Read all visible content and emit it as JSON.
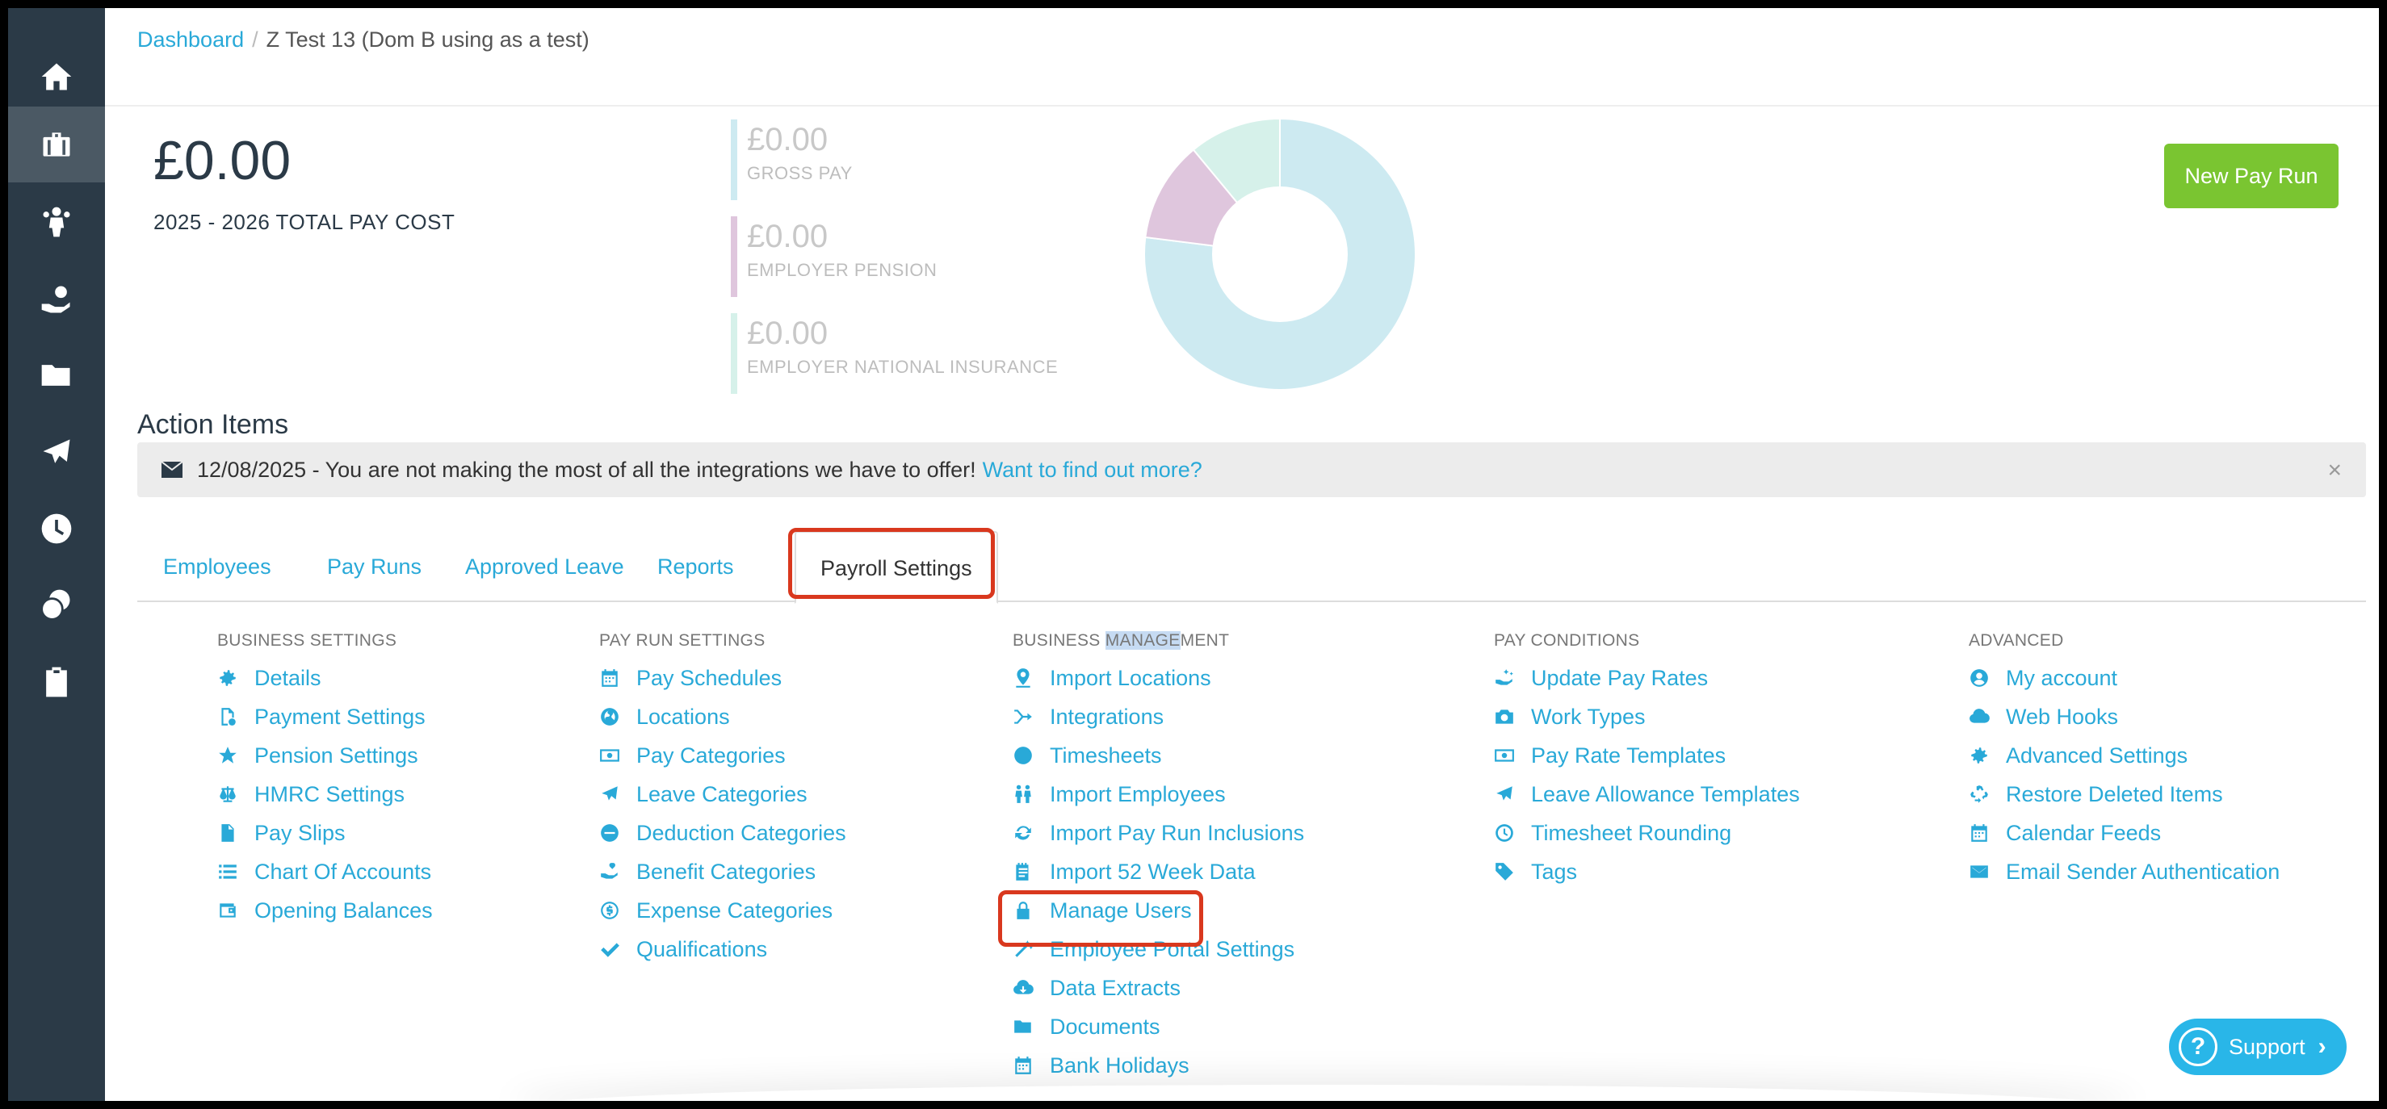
{
  "breadcrumb": {
    "root": "Dashboard",
    "separator": "/",
    "current": "Z Test 13 (Dom B using as a test)"
  },
  "summary": {
    "total_amount": "£0.00",
    "total_label": "2025 - 2026 TOTAL PAY COST",
    "stats": [
      {
        "amount": "£0.00",
        "label": "GROSS PAY",
        "color": "#cdeaf1"
      },
      {
        "amount": "£0.00",
        "label": "EMPLOYER PENSION",
        "color": "#dfc6dd"
      },
      {
        "amount": "£0.00",
        "label": "EMPLOYER NATIONAL INSURANCE",
        "color": "#d6f1ea"
      }
    ],
    "donut": [
      {
        "share": 0.77,
        "color": "#cdeaf1"
      },
      {
        "share": 0.12,
        "color": "#dfc6dd"
      },
      {
        "share": 0.11,
        "color": "#d6f1ea"
      }
    ]
  },
  "new_payrun_label": "New Pay Run",
  "action_items": {
    "title": "Action Items",
    "alert_text": "12/08/2025 - You are not making the most of all the integrations we have to offer!",
    "alert_link": "Want to find out more?",
    "close": "×"
  },
  "tabs": [
    "Employees",
    "Pay Runs",
    "Approved Leave",
    "Reports",
    "Payroll Settings"
  ],
  "sections": {
    "business_settings": {
      "heading": "BUSINESS SETTINGS",
      "items": [
        "Details",
        "Payment Settings",
        "Pension Settings",
        "HMRC Settings",
        "Pay Slips",
        "Chart Of Accounts",
        "Opening Balances"
      ]
    },
    "pay_run_settings": {
      "heading": "PAY RUN SETTINGS",
      "items": [
        "Pay Schedules",
        "Locations",
        "Pay Categories",
        "Leave Categories",
        "Deduction Categories",
        "Benefit Categories",
        "Expense Categories",
        "Qualifications"
      ]
    },
    "business_management": {
      "heading_pre": "BUSINESS ",
      "heading_sel": "MANAGE",
      "heading_post": "MENT",
      "items": [
        "Import Locations",
        "Integrations",
        "Timesheets",
        "Import Employees",
        "Import Pay Run Inclusions",
        "Import 52 Week Data",
        "Manage Users",
        "Employee Portal Settings",
        "Data Extracts",
        "Documents",
        "Bank Holidays"
      ]
    },
    "pay_conditions": {
      "heading": "PAY CONDITIONS",
      "items": [
        "Update Pay Rates",
        "Work Types",
        "Pay Rate Templates",
        "Leave Allowance Templates",
        "Timesheet Rounding",
        "Tags"
      ]
    },
    "advanced": {
      "heading": "ADVANCED",
      "items": [
        "My account",
        "Web Hooks",
        "Advanced Settings",
        "Restore Deleted Items",
        "Calendar Feeds",
        "Email Sender Authentication"
      ]
    }
  },
  "support_label": "Support",
  "accent_color": "#29a9d8",
  "highlight_color": "#d9381e"
}
